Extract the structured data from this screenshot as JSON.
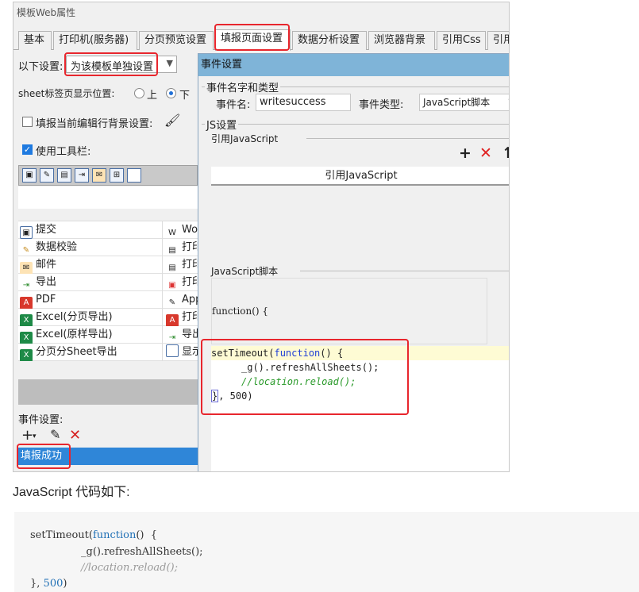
{
  "dialog_title": "模板Web属性",
  "tabs": [
    "基本",
    "打印机(服务器)",
    "分页预览设置",
    "填报页面设置",
    "数据分析设置",
    "浏览器背景",
    "引用Css",
    "引用"
  ],
  "active_tab": "填报页面设置",
  "left": {
    "settings_label": "以下设置:",
    "settings_dropdown": "为该模板单独设置",
    "sheet_position_label": "sheet标签页显示位置:",
    "radio_top": "上",
    "radio_bottom": "下",
    "row_bg_label": "填报当前编辑行背景设置:",
    "use_toolbar_label": "使用工具栏:",
    "toolbar_icons": [
      "save-icon",
      "validate-icon",
      "print-icon",
      "export-icon",
      "mail-icon",
      "sheet-icon",
      "blank-icon"
    ],
    "button_rows": [
      {
        "icon": "save-icon",
        "label": "提交",
        "col2": "Wo"
      },
      {
        "icon": "validate-icon",
        "label": "数据校验",
        "col2": "打印"
      },
      {
        "icon": "mail-icon",
        "label": "邮件",
        "col2": "打印"
      },
      {
        "icon": "export-icon",
        "label": "导出",
        "col2": "打印"
      },
      {
        "icon": "pdf-icon",
        "label": "PDF",
        "col2": "App"
      },
      {
        "icon": "excel-icon",
        "label": "Excel(分页导出)",
        "col2": "打印"
      },
      {
        "icon": "excel-icon",
        "label": "Excel(原样导出)",
        "col2": "导出"
      },
      {
        "icon": "sheet-export-icon",
        "label": "分页分Sheet导出",
        "col2": "显示"
      }
    ],
    "event_settings_label": "事件设置:",
    "event_selected": "填报成功"
  },
  "event_dialog": {
    "title": "事件设置",
    "name_type_group": "事件名字和类型",
    "event_name_label": "事件名:",
    "event_name_value": "writesuccess",
    "event_type_label": "事件类型:",
    "event_type_value": "JavaScript脚本",
    "js_settings_group": "JS设置",
    "ref_js_label": "引用JavaScript",
    "ref_js_column": "引用JavaScript",
    "script_label": "JavaScript脚本",
    "function_header": "function() {",
    "code": {
      "line1_fn": "setTimeout(",
      "line1_kw": "function",
      "line1_end": "() {",
      "line2": "_g().refreshAllSheets();",
      "line3": "//location.reload();",
      "line4_end": "}",
      "line4_rest": ", 500)"
    }
  },
  "doc": {
    "heading": "JavaScript 代码如下:",
    "code": {
      "l1_fn": "setTimeout(",
      "l1_kw": "function",
      "l1_rest": "()  {",
      "l2": "_g().refreshAllSheets();",
      "l3": "//location.reload();",
      "l4_a": "},",
      "l4_num": "500",
      "l4_b": ")"
    }
  },
  "colors": {
    "highlight_red": "#e8262d",
    "selection_blue": "#2f86d8",
    "titlebar_blue": "#7fb4d8"
  }
}
